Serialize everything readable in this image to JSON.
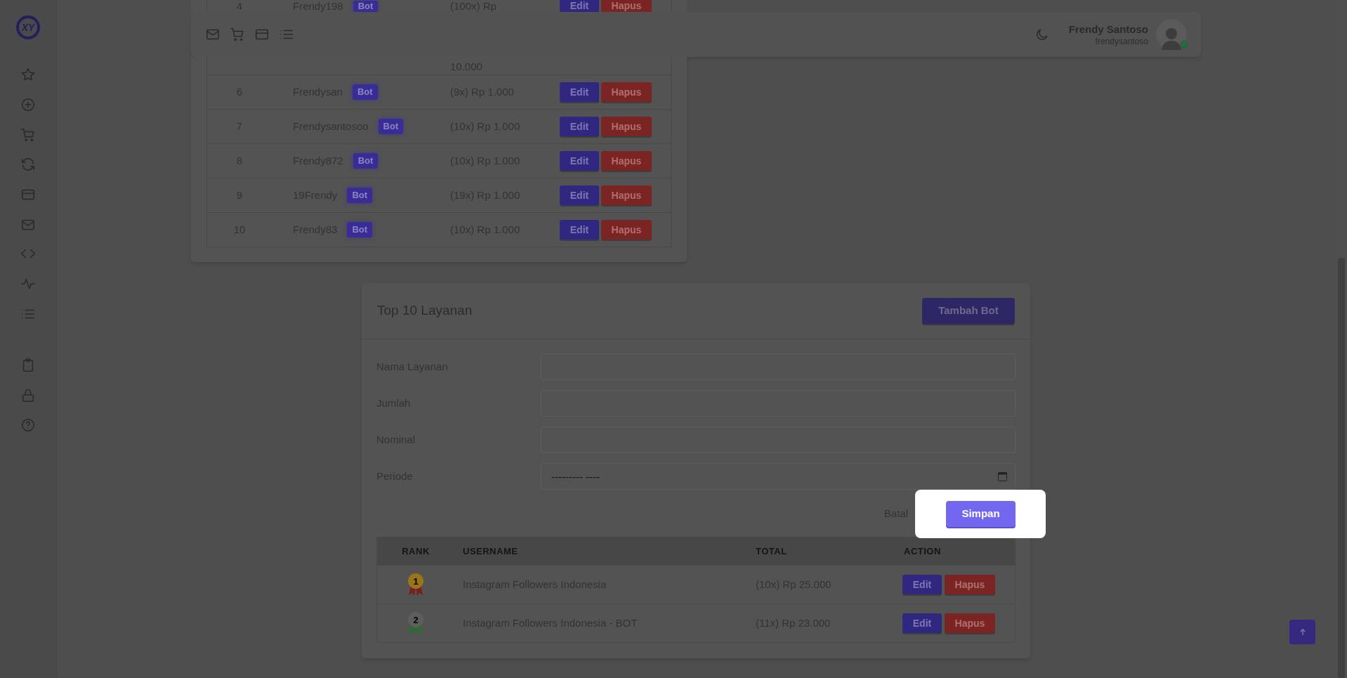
{
  "sidebar": {
    "logo": "XY"
  },
  "header": {
    "user_name": "Frendy Santoso",
    "user_handle": "frendysantoso",
    "online": true
  },
  "top_table": {
    "rows": [
      {
        "kind": "clipped",
        "rank": "4",
        "username": "Frendy198",
        "badge": "Bot",
        "total": "(100x) Rp",
        "actions": [
          "Edit",
          "Hapus"
        ]
      },
      {
        "kind": "tail",
        "total": "10.000"
      },
      {
        "kind": "full",
        "rank": "6",
        "username": "Frendysan",
        "badge": "Bot",
        "total": "(9x) Rp 1.000",
        "actions": [
          "Edit",
          "Hapus"
        ]
      },
      {
        "kind": "full",
        "rank": "7",
        "username": "Frendysantosoo",
        "badge": "Bot",
        "total": "(10x) Rp 1.000",
        "actions": [
          "Edit",
          "Hapus"
        ]
      },
      {
        "kind": "full",
        "rank": "8",
        "username": "Frendy872",
        "badge": "Bot",
        "total": "(10x) Rp 1.000",
        "actions": [
          "Edit",
          "Hapus"
        ]
      },
      {
        "kind": "full",
        "rank": "9",
        "username": "19Frendy",
        "badge": "Bot",
        "total": "(19x) Rp 1.000",
        "actions": [
          "Edit",
          "Hapus"
        ]
      },
      {
        "kind": "full",
        "rank": "10",
        "username": "Frendy83",
        "badge": "Bot",
        "total": "(10x) Rp 1.000",
        "actions": [
          "Edit",
          "Hapus"
        ]
      }
    ]
  },
  "card": {
    "title": "Top 10 Layanan",
    "add_button": "Tambah Bot",
    "fields": [
      {
        "label": "Nama Layanan",
        "kind": "text"
      },
      {
        "label": "Jumlah",
        "kind": "text"
      },
      {
        "label": "Nominal",
        "kind": "text"
      },
      {
        "label": "Periode",
        "kind": "date",
        "placeholder": "--------- ----"
      }
    ],
    "cancel": "Batal",
    "save": "Simpan",
    "save_highlighted": true,
    "table": {
      "columns": [
        "RANK",
        "USERNAME",
        "TOTAL",
        "ACTION"
      ],
      "rows": [
        {
          "color": "#9a7418",
          "rank": "1",
          "username": "Instagram Followers Indonesia",
          "total": "(10x) Rp 25.000",
          "actions": [
            "Edit",
            "Hapus"
          ]
        },
        {
          "color": "#5e5e5e",
          "rank": "2",
          "username": "Instagram Followers Indonesia - BOT",
          "total": "(11x) Rp 23.000",
          "actions": [
            "Edit",
            "Hapus"
          ]
        }
      ]
    }
  }
}
